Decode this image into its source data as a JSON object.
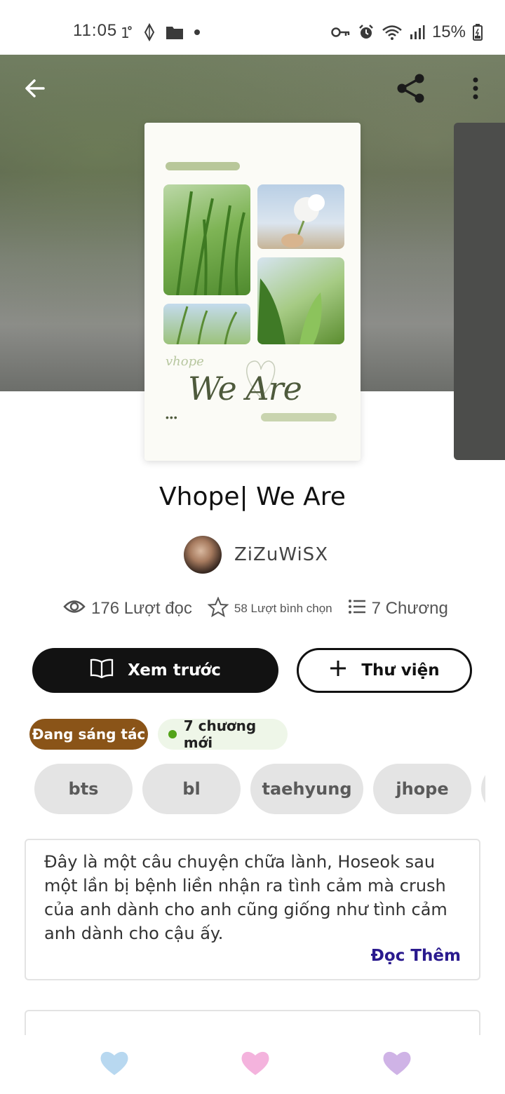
{
  "status_bar": {
    "time": "11:05",
    "battery_percent": "15%",
    "left_icons": [
      "temperature-icon",
      "location-icon",
      "folder-icon",
      "dot-icon"
    ],
    "right_icons": [
      "key-icon",
      "alarm-icon",
      "wifi-icon",
      "signal-icon",
      "battery-icon"
    ]
  },
  "header": {
    "back_icon": "back-arrow-icon",
    "share_icon": "share-icon",
    "more_icon": "more-vertical-icon"
  },
  "cover": {
    "small_text": "vhope",
    "title_text": "We Are",
    "dots": "•••"
  },
  "story": {
    "title": "Vhope| We Are",
    "author": "ZiZuWiSX"
  },
  "stats": {
    "reads": "176 Lượt đọc",
    "votes": "58 Lượt bình chọn",
    "chapters": "7 Chương"
  },
  "actions": {
    "preview_label": "Xem trước",
    "library_label": "Thư viện"
  },
  "badges": {
    "status": "Đang sáng tác",
    "new_chapters": "7 chương mới"
  },
  "tags": [
    "bts",
    "bl",
    "taehyung",
    "jhope",
    ""
  ],
  "description": {
    "text": "Đây là một câu chuyện chữa lành, Hoseok sau một lần bị bệnh liền nhận ra tình cảm mà crush của anh dành cho anh cũng giống như tình cảm anh dành cho cậu ấy.",
    "read_more": "Đọc Thêm"
  },
  "bottom_bar": {
    "hearts": [
      {
        "icon": "heart-icon",
        "color": "#b8d8f0"
      },
      {
        "icon": "heart-icon",
        "color": "#f4b3dd"
      },
      {
        "icon": "heart-icon",
        "color": "#cfb3e6"
      }
    ]
  },
  "colors": {
    "status_badge": "#8a5418",
    "new_dot": "#53a319",
    "read_more": "#2a1a8e",
    "primary_button": "#121212"
  }
}
